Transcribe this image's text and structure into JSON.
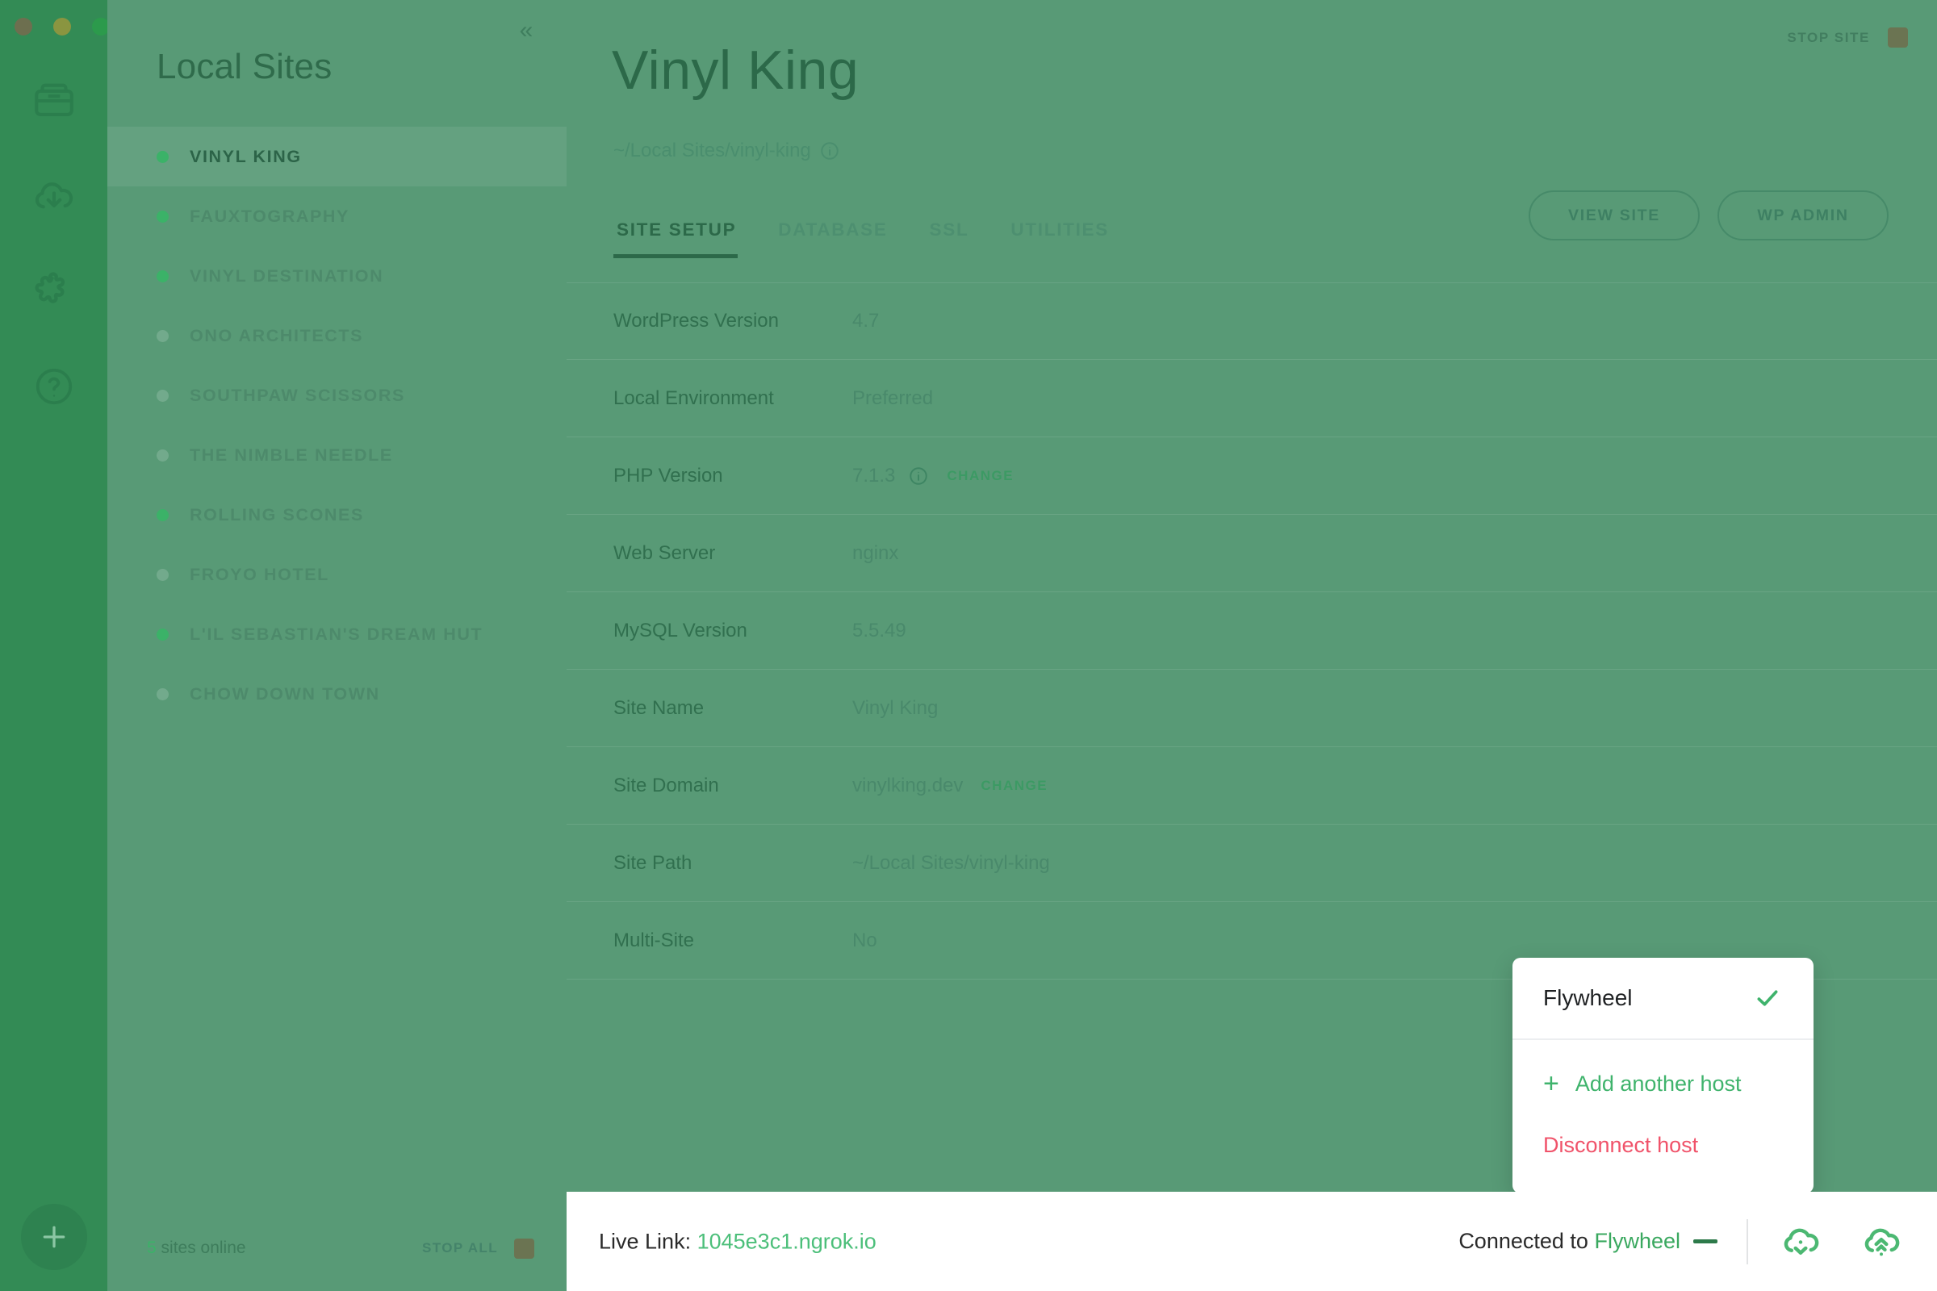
{
  "window": {
    "traffic_lights": [
      "close",
      "minimize",
      "zoom"
    ],
    "collapse_icon": "chevron-double-left-icon"
  },
  "rail": {
    "items": [
      {
        "icon": "sites-drawer-icon",
        "name": "sites"
      },
      {
        "icon": "cloud-download-icon",
        "name": "pull-from-host"
      },
      {
        "icon": "blueprint-puzzle-icon",
        "name": "blueprints"
      },
      {
        "icon": "help-circle-icon",
        "name": "help"
      }
    ],
    "add_button": {
      "icon": "plus-icon",
      "label": "+"
    }
  },
  "sidebar": {
    "title": "Local Sites",
    "sites": [
      {
        "name": "VINYL KING",
        "online": true,
        "active": true
      },
      {
        "name": "FAUXTOGRAPHY",
        "online": true,
        "active": false
      },
      {
        "name": "VINYL DESTINATION",
        "online": true,
        "active": false
      },
      {
        "name": "ONO ARCHITECTS",
        "online": false,
        "active": false
      },
      {
        "name": "SOUTHPAW SCISSORS",
        "online": false,
        "active": false
      },
      {
        "name": "THE NIMBLE NEEDLE",
        "online": false,
        "active": false
      },
      {
        "name": "ROLLING SCONES",
        "online": true,
        "active": false
      },
      {
        "name": "FROYO HOTEL",
        "online": false,
        "active": false
      },
      {
        "name": "L'IL SEBASTIAN'S DREAM HUT",
        "online": true,
        "active": false
      },
      {
        "name": "CHOW DOWN TOWN",
        "online": false,
        "active": false
      }
    ],
    "footer": {
      "online_count": "5",
      "online_label": " sites online",
      "stop_all_label": "STOP ALL",
      "stop_icon": "stop-square-icon"
    }
  },
  "main": {
    "stop_site": {
      "label": "STOP SITE",
      "icon": "stop-square-icon"
    },
    "title": "Vinyl King",
    "path": "~/Local Sites/vinyl-king",
    "path_info_icon": "info-circle-icon",
    "tabs": [
      {
        "label": "SITE SETUP",
        "active": true
      },
      {
        "label": "DATABASE",
        "active": false
      },
      {
        "label": "SSL",
        "active": false
      },
      {
        "label": "UTILITIES",
        "active": false
      }
    ],
    "actions": [
      {
        "label": "VIEW SITE"
      },
      {
        "label": "WP ADMIN"
      }
    ],
    "details": [
      {
        "label": "WordPress Version",
        "value": "4.7",
        "info": false,
        "change": ""
      },
      {
        "label": "Local Environment",
        "value": "Preferred",
        "info": false,
        "change": ""
      },
      {
        "label": "PHP Version",
        "value": "7.1.3",
        "info": true,
        "change": "CHANGE"
      },
      {
        "label": "Web Server",
        "value": "nginx",
        "info": false,
        "change": ""
      },
      {
        "label": "MySQL Version",
        "value": "5.5.49",
        "info": false,
        "change": ""
      },
      {
        "label": "Site Name",
        "value": "Vinyl King",
        "info": false,
        "change": ""
      },
      {
        "label": "Site Domain",
        "value": "vinylking.dev",
        "info": false,
        "change": "CHANGE"
      },
      {
        "label": "Site Path",
        "value": "~/Local Sites/vinyl-king",
        "info": false,
        "change": ""
      },
      {
        "label": "Multi-Site",
        "value": "No",
        "info": false,
        "change": ""
      }
    ]
  },
  "bottom_bar": {
    "live_link_label": "Live Link:",
    "live_link_url": "1045e3c1.ngrok.io",
    "connected_label": "Connected to",
    "connected_host": "Flywheel",
    "collapse_dash": "—",
    "pull_icon": "cloud-pull-icon",
    "push_icon": "cloud-push-icon"
  },
  "host_popup": {
    "current_host": "Flywheel",
    "check_icon": "check-icon",
    "add_host_label": "Add another host",
    "add_host_icon": "plus-icon",
    "disconnect_label": "Disconnect host"
  },
  "colors": {
    "brand_green": "#3fb36c",
    "rail_green": "#338b55",
    "panel_green": "#589a76",
    "danger_red": "#f0536a",
    "link_green": "#4cbf7a"
  }
}
